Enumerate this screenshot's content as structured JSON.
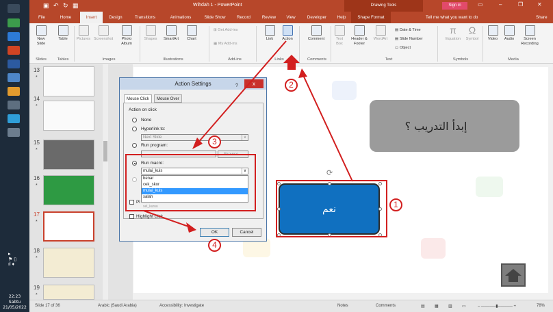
{
  "taskbar": {
    "time": "22:23",
    "day": "Sabtu",
    "date": "21/05/2022"
  },
  "titlebar": {
    "title": "Wihdah 1 - PowerPoint",
    "context": "Drawing Tools",
    "signin": "Sign in"
  },
  "tabs": [
    "File",
    "Home",
    "Insert",
    "Design",
    "Transitions",
    "Animations",
    "Slide Show",
    "Record",
    "Review",
    "View",
    "Developer",
    "Help",
    "Shape Format"
  ],
  "tell_me": "Tell me what you want to do",
  "share": "Share",
  "ribbon": {
    "new_slide": "New Slide",
    "table": "Table",
    "pictures": "Pictures",
    "screenshot": "Screenshot",
    "photo_album": "Photo Album",
    "shapes": "Shapes",
    "smartart": "SmartArt",
    "chart": "Chart",
    "get_addins": "Get Add-ins",
    "my_addins": "My Add-ins",
    "link": "Link",
    "action": "Action",
    "comment": "Comment",
    "textbox": "Text Box",
    "header_footer": "Header & Footer",
    "wordart": "WordArt",
    "date_time": "Date & Time",
    "slide_number": "Slide Number",
    "object": "Object",
    "equation": "Equation",
    "symbol": "Symbol",
    "video": "Video",
    "audio": "Audio",
    "screen_recording": "Screen Recording",
    "groups": [
      "Slides",
      "Tables",
      "Images",
      "Illustrations",
      "Add-ins",
      "Links",
      "Comments",
      "Text",
      "Symbols",
      "Media"
    ]
  },
  "thumbnails": [
    {
      "num": "13",
      "star": "*"
    },
    {
      "num": "14",
      "star": "*"
    },
    {
      "num": "15",
      "star": "*"
    },
    {
      "num": "16",
      "star": "*"
    },
    {
      "num": "17",
      "star": "*"
    },
    {
      "num": "18",
      "star": "*"
    },
    {
      "num": "19",
      "star": "*"
    }
  ],
  "slide": {
    "question": "إبدأ التدريب ؟",
    "yes_button": "نعم"
  },
  "dialog": {
    "title": "Action Settings",
    "help": "?",
    "close": "x",
    "tab_mouse_click": "Mouse Click",
    "tab_mouse_over": "Mouse Over",
    "action_on_click": "Action on click",
    "none": "None",
    "hyperlink_to": "Hyperlink to:",
    "hyperlink_value": "Next Slide",
    "run_program": "Run program:",
    "browse": "Browse...",
    "run_macro": "Run macro:",
    "macro_value": "mulai_kuis",
    "macro_options": [
      "benar",
      "cek_skor",
      "mulai_kuis",
      "salah"
    ],
    "macro_partial": "sel_kuruu",
    "play_sound_partial": "Pl",
    "highlight_click": "Highlight click",
    "ok": "OK",
    "cancel": "Cancel"
  },
  "annotations": [
    "1",
    "2",
    "3",
    "4"
  ],
  "statusbar": {
    "slide_of": "Slide 17 of 36",
    "language": "Arabic (Saudi Arabia)",
    "accessibility": "Accessibility: Investigate",
    "notes": "Notes",
    "comments": "Comments",
    "zoom": "78%"
  }
}
